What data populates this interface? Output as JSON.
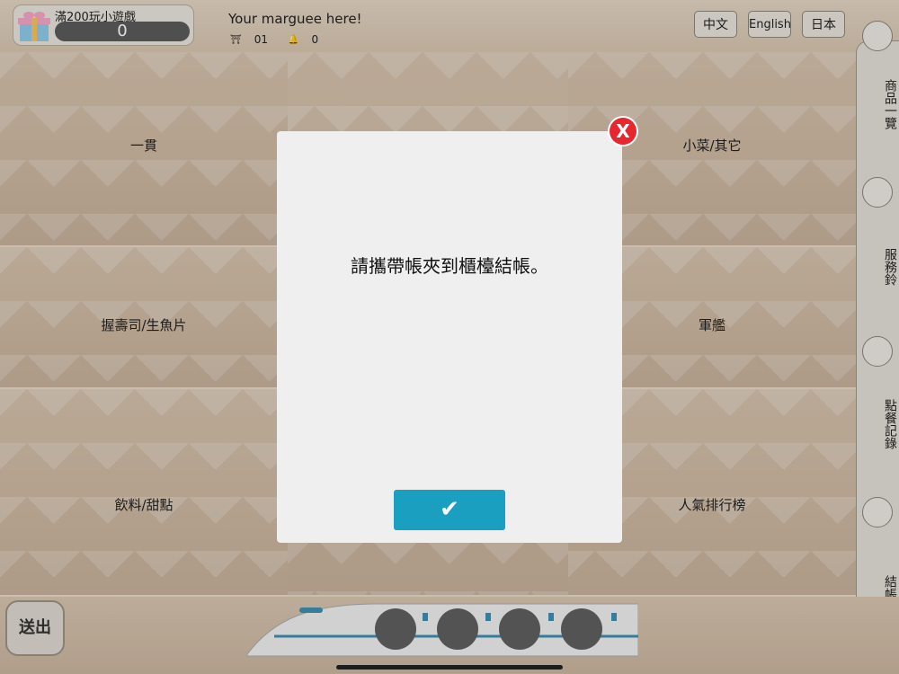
{
  "gift": {
    "title": "滿200玩小遊戲",
    "score": "0"
  },
  "marquee": "Your marguee here!",
  "stats": {
    "table_value": "01",
    "bell_value": "0",
    "table_icon": "⛩",
    "bell_icon": "🔔"
  },
  "languages": [
    "中文",
    "English",
    "日本"
  ],
  "categories": [
    "一貫",
    "小菜/其它",
    "握壽司/生魚片",
    "軍艦",
    "飲料/甜點",
    "人氣排行榜"
  ],
  "sidebar": {
    "items": [
      {
        "label": "商品一覽",
        "icon": "menu-icon"
      },
      {
        "label": "服務鈴",
        "icon": "person-icon"
      },
      {
        "label": "點餐記錄",
        "icon": "document-icon"
      },
      {
        "label": "結帳",
        "icon": "dollar-icon"
      }
    ]
  },
  "send_label": "送出",
  "modal": {
    "message": "請攜帶帳夾到櫃檯結帳。",
    "confirm_symbol": "✔",
    "close_symbol": "X"
  },
  "colors": {
    "accent": "#1a9fc0",
    "close": "#e8262d"
  }
}
